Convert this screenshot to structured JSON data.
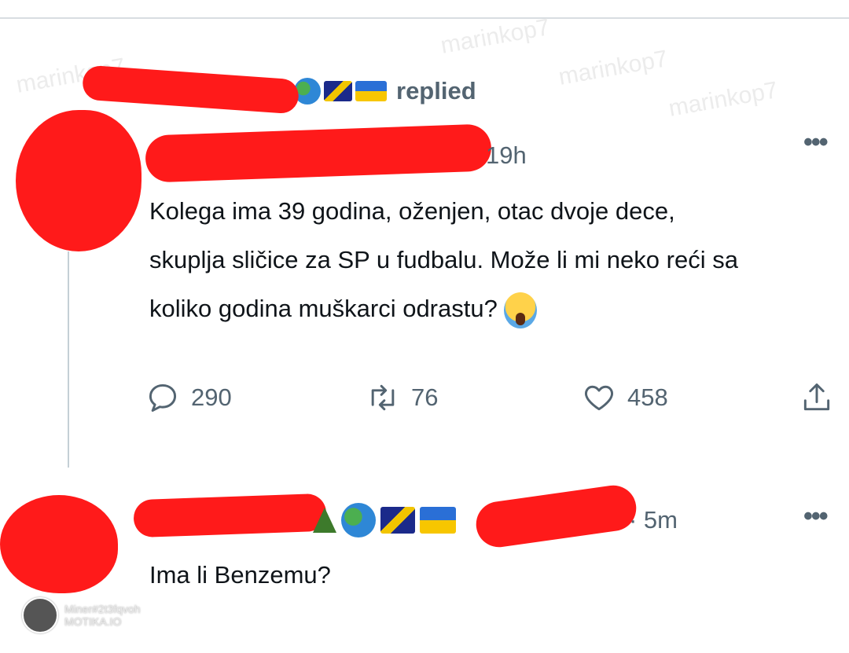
{
  "retweet_header": {
    "label": "replied"
  },
  "tweet": {
    "time": "19h",
    "lines": [
      "Kolega ima 39 godina, oženjen, otac dvoje dece,",
      "skuplja sličice za SP u fudbalu. Može li mi neko reći sa",
      "koliko godina muškarci odrastu?"
    ],
    "replies": "290",
    "retweets": "76",
    "likes": "458"
  },
  "reply": {
    "time": "· 5m",
    "text": "Ima li Benzemu?"
  },
  "watermark": {
    "line1": "Miner#2t3fqvoh",
    "line2": "MOTIKA.IO"
  },
  "icons": {
    "tree": "evergreen-tree-emoji",
    "globe": "globe-americas-emoji",
    "flag1": "bosnia-flag-emoji",
    "flag2": "ukraine-flag-emoji",
    "scream": "face-screaming-emoji",
    "reply": "reply-icon",
    "retweet": "retweet-icon",
    "like": "heart-icon",
    "share": "share-icon",
    "more": "more-options-icon"
  },
  "colors": {
    "redaction": "#ff1a1a",
    "secondary_text": "#536471",
    "primary_text": "#0f1419"
  }
}
